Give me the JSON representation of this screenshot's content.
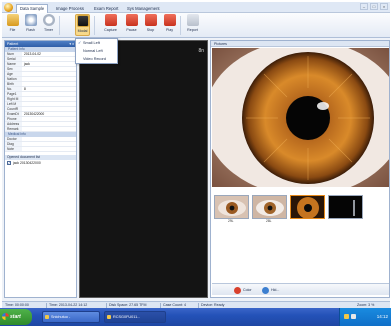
{
  "tabs": [
    "Data Sample",
    "Image Process",
    "Exam Report",
    "Sys Management"
  ],
  "active_tab": 0,
  "ribbon": {
    "buttons": [
      {
        "label": "File",
        "icon": "folder-icon",
        "color": "#e7b43a"
      },
      {
        "label": "Flash",
        "icon": "flash-icon",
        "color": "#8ea6c8"
      },
      {
        "label": "Timer",
        "icon": "timer-icon",
        "color": "#a9b4c4"
      },
      {
        "label": "Modal",
        "icon": "mode-icon",
        "color": "#d4a43c"
      },
      {
        "label": "Capture",
        "icon": "capture-icon",
        "color": "#e0422d"
      },
      {
        "label": "Pause",
        "icon": "pause-icon",
        "color": "#e0422d"
      },
      {
        "label": "Stop",
        "icon": "stop-icon",
        "color": "#e0422d"
      },
      {
        "label": "Play",
        "icon": "play-icon",
        "color": "#e0422d"
      },
      {
        "label": "Report",
        "icon": "report-icon",
        "color": "#b8c0cc"
      }
    ]
  },
  "dropdown": {
    "items": [
      {
        "label": "Small Left",
        "checked": true
      },
      {
        "label": "Normal Left",
        "checked": false
      },
      {
        "label": "Video Record",
        "checked": false
      }
    ]
  },
  "left_panel": {
    "title": "Patient",
    "pin": "▾ x",
    "section_1": "Patient Info",
    "rows": [
      {
        "k": "Num",
        "v": "2013-04-02"
      },
      {
        "k": "Serial",
        "v": ""
      },
      {
        "k": "Name",
        "v": "jack"
      },
      {
        "k": "Sex",
        "v": ""
      },
      {
        "k": "Age",
        "v": ""
      },
      {
        "k": "Nation",
        "v": ""
      },
      {
        "k": "Birth",
        "v": ""
      },
      {
        "k": "No.",
        "v": "8"
      },
      {
        "k": "Page1",
        "v": ""
      },
      {
        "k": "Right M",
        "v": ""
      },
      {
        "k": "Left M",
        "v": ""
      },
      {
        "k": "CountR",
        "v": ""
      },
      {
        "k": "ExamDt",
        "v": "20130422000"
      },
      {
        "k": "Phone",
        "v": ""
      },
      {
        "k": "Address",
        "v": ""
      },
      {
        "k": "Remark",
        "v": ""
      }
    ],
    "section_2": "Medical Info",
    "rows2": [
      {
        "k": "Doctor",
        "v": ""
      },
      {
        "k": "Diag",
        "v": ""
      },
      {
        "k": "Note",
        "v": ""
      }
    ],
    "docs_title": "Opened document list",
    "docs": [
      {
        "label": "jack 20130422000",
        "checked": true
      }
    ]
  },
  "live": {
    "label": "8n"
  },
  "pictures": {
    "title": "Pictures",
    "thumb_captions": [
      "29L",
      "28L",
      "",
      ""
    ],
    "footer": [
      {
        "label": "Color",
        "icon": "color-icon",
        "color": "#d8402c"
      },
      {
        "label": "Hid...",
        "icon": "hide-icon",
        "color": "#3c7fd0"
      }
    ]
  },
  "status": {
    "time": "Time: 00:00:00",
    "date": "Time: 2013-04-22 14:12",
    "disk": "Disk Space: 27.65 TFM",
    "count": "Case Count: 4",
    "device": "Device: Ready",
    "zoom": "Zoom: 3 %"
  },
  "taskbar": {
    "start": "start",
    "items": [
      {
        "label": "Snichutuo -",
        "active": false
      },
      {
        "label": "RCSG0FU011...",
        "active": true
      }
    ],
    "clock": "14:12"
  }
}
